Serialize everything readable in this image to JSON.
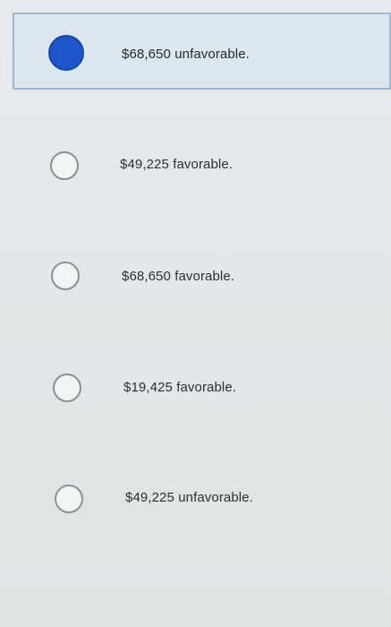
{
  "options": [
    {
      "label": "$68,650 unfavorable.",
      "selected": true
    },
    {
      "label": "$49,225 favorable.",
      "selected": false
    },
    {
      "label": "$68,650 favorable.",
      "selected": false
    },
    {
      "label": "$19,425 favorable.",
      "selected": false
    },
    {
      "label": "$49,225 unfavorable.",
      "selected": false
    }
  ],
  "colors": {
    "selected_radio": "#1d56c9",
    "selected_background": "#dde6ee",
    "selected_border": "#9db7cf",
    "unselected_radio_border": "#8a9094"
  }
}
